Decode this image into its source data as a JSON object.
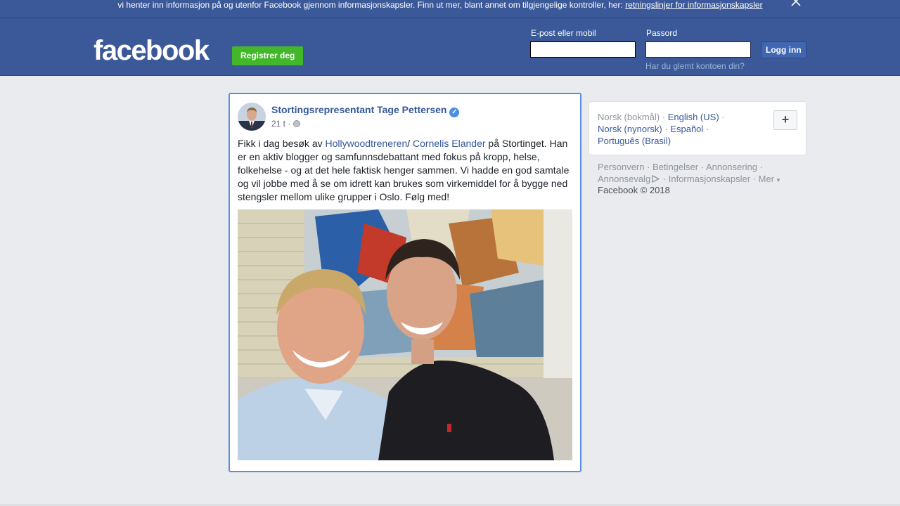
{
  "cookie_banner": {
    "text": "vi henter inn informasjon på og utenfor Facebook gjennom informasjonskapsler. Finn ut mer, blant annet om tilgjengelige kontroller, her: ",
    "link": "retningslinjer for informasjonskapsler",
    "close_icon": "close-icon"
  },
  "header": {
    "logo": "facebook",
    "register_label": "Registrer deg",
    "email_label": "E-post eller mobil",
    "password_label": "Passord",
    "email_value": "",
    "password_value": "",
    "login_label": "Logg inn",
    "forgot_label": "Har du glemt kontoen din?"
  },
  "post": {
    "author": "Stortingsrepresentant Tage Pettersen",
    "verified_icon": "verified-badge-icon",
    "time": "21 t ·",
    "privacy_icon": "globe-icon",
    "text_before": "Fikk i dag besøk av ",
    "link1": "Hollywoodtreneren",
    "text_mid": "/ ",
    "link2": "Cornelis Elander",
    "text_after": " på Stortinget. Han er en aktiv blogger og samfunnsdebattant med fokus på kropp, helse, folkehelse - og at det hele faktisk henger sammen. Vi hadde en god samtale og vil jobbe med å se om idrett kan brukes som virkemiddel for å bygge ned stengsler mellom ulike grupper i Oslo. Følg med!"
  },
  "languages": {
    "current": "Norsk (bokmål)",
    "items": [
      "English (US)",
      "Norsk (nynorsk)",
      "Español",
      "Português (Brasil)"
    ],
    "add_icon": "plus-icon",
    "add_label": "+"
  },
  "footer": {
    "links": [
      "Personvern",
      "Betingelser",
      "Annonsering",
      "Annonsevalg",
      "Informasjonskapsler",
      "Mer"
    ],
    "adchoices_icon": "adchoices-icon",
    "more_icon": "caret-down-icon",
    "copyright": "Facebook © 2018"
  },
  "colors": {
    "brand_blue": "#3b5998",
    "register_green": "#42b72a",
    "link_blue": "#365899",
    "focus_border": "#5b8ae8"
  }
}
